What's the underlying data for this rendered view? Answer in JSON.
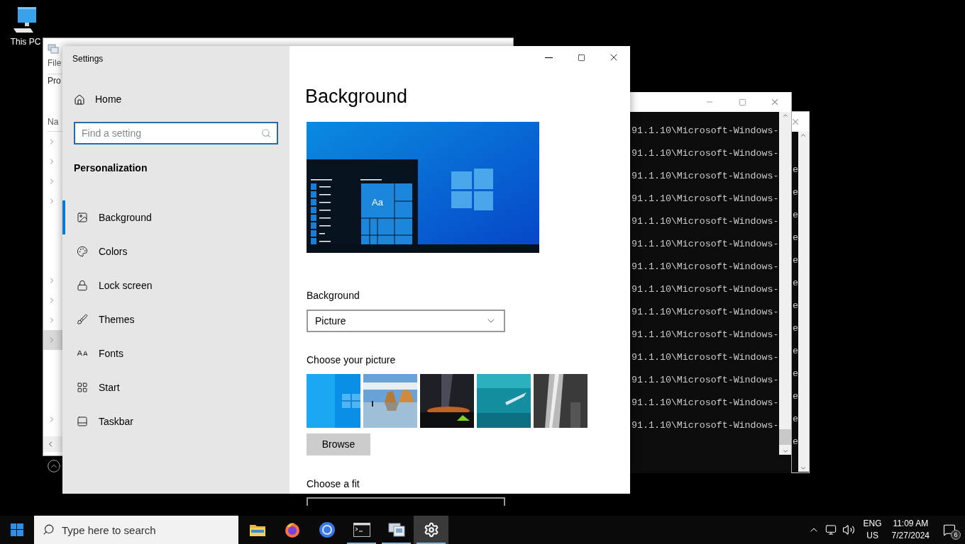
{
  "desktop_icons": [
    {
      "label": "This PC"
    }
  ],
  "explorer_window": {
    "menu": "File",
    "ribbon": "Pro",
    "column": "Na",
    "row_groups": [
      [
        {
          "highlighted": false
        },
        {
          "highlighted": false
        },
        {
          "highlighted": false
        },
        {
          "highlighted": false
        }
      ],
      [
        {
          "highlighted": false
        },
        {
          "highlighted": false
        },
        {
          "highlighted": false
        },
        {
          "highlighted": true
        }
      ],
      [
        {
          "highlighted": false
        }
      ]
    ]
  },
  "console_back": {
    "lines": [
      "e",
      "e",
      "e",
      "e",
      "e",
      "e",
      "e",
      "e",
      "e",
      "e",
      "e",
      "e",
      "e"
    ]
  },
  "console": {
    "lines": [
      "91.1.10\\Microsoft-Windows-",
      "91.1.10\\Microsoft-Windows-",
      "91.1.10\\Microsoft-Windows-",
      "91.1.10\\Microsoft-Windows-",
      "91.1.10\\Microsoft-Windows-",
      "91.1.10\\Microsoft-Windows-",
      "91.1.10\\Microsoft-Windows-",
      "91.1.10\\Microsoft-Windows-",
      "91.1.10\\Microsoft-Windows-",
      "91.1.10\\Microsoft-Windows-",
      "91.1.10\\Microsoft-Windows-",
      "91.1.10\\Microsoft-Windows-",
      "91.1.10\\Microsoft-Windows-",
      "91.1.10\\Microsoft-Windows-"
    ]
  },
  "settings": {
    "title": "Settings",
    "nav": {
      "home": "Home",
      "search_placeholder": "Find a setting",
      "section": "Personalization",
      "items": [
        {
          "label": "Background",
          "kind": "background",
          "selected": true
        },
        {
          "label": "Colors",
          "kind": "colors",
          "selected": false
        },
        {
          "label": "Lock screen",
          "kind": "lock",
          "selected": false
        },
        {
          "label": "Themes",
          "kind": "themes",
          "selected": false
        },
        {
          "label": "Fonts",
          "kind": "fonts",
          "selected": false
        },
        {
          "label": "Start",
          "kind": "start",
          "selected": false
        },
        {
          "label": "Taskbar",
          "kind": "taskbar",
          "selected": false
        }
      ]
    },
    "page": {
      "heading": "Background",
      "preview_tile": "Aa",
      "background_label": "Background",
      "background_value": "Picture",
      "picture_label": "Choose your picture",
      "browse": "Browse",
      "fit_label": "Choose a fit"
    }
  },
  "taskbar": {
    "search_placeholder": "Type here to search",
    "apps": [
      {
        "kind": "folder",
        "active": false,
        "running": false
      },
      {
        "kind": "firefox",
        "active": false,
        "running": false
      },
      {
        "kind": "chrome",
        "active": false,
        "running": false
      },
      {
        "kind": "terminal",
        "active": false,
        "running": true
      },
      {
        "kind": "server",
        "active": false,
        "running": true
      },
      {
        "kind": "settings",
        "active": true,
        "running": true
      }
    ],
    "language": "ENG",
    "region": "US",
    "time": "11:09 AM",
    "date": "7/27/2024",
    "notifications": "6"
  }
}
